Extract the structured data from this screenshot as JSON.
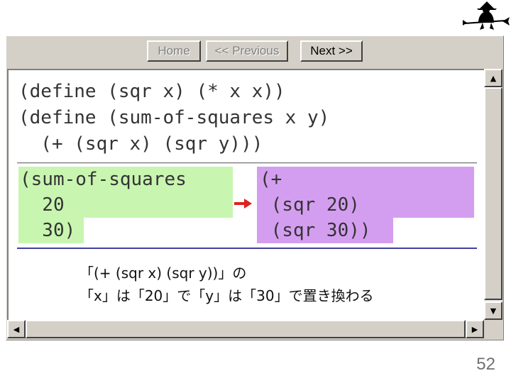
{
  "nav": {
    "home_label": "Home",
    "prev_label": "<< Previous",
    "next_label": "Next >>"
  },
  "code": {
    "definitions": "(define (sqr x) (* x x))\n(define (sum-of-squares x y)\n  (+ (sqr x) (sqr y)))"
  },
  "expression": {
    "lines": [
      "(sum-of-squares",
      "  20",
      "  30)"
    ]
  },
  "expansion": {
    "lines": [
      "(+",
      " (sqr 20)",
      " (sqr 30))"
    ]
  },
  "caption": {
    "line1": "「(+ (sqr x) (sqr y))」の",
    "line2": "「x」は「20」で「y」は「30」で置き換わる"
  },
  "slide": {
    "page_number": "52"
  },
  "colors": {
    "green_highlight": "#c8f5b0",
    "purple_highlight": "#d49ef0",
    "arrow": "#e02020"
  },
  "icons": {
    "logo": "witch-on-broom-icon",
    "arrow": "arrow-right-icon"
  }
}
